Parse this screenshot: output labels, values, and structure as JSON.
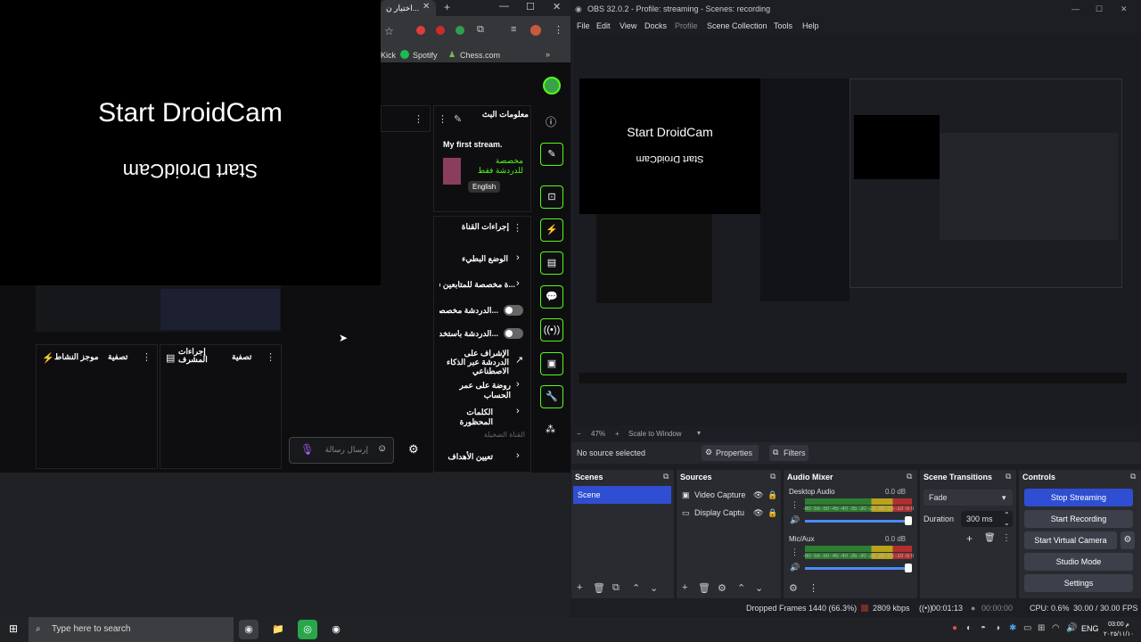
{
  "chrome": {
    "tab_title": "اختيار ن...",
    "bookmarks": [
      "Kick",
      "Spotify",
      "Chess.com"
    ],
    "droidcam_text": "Start DroidCam",
    "stream_info_title": "معلومات البث",
    "stream_name": "My first stream.",
    "stream_category": "مخصصة للدردشة فقط",
    "stream_language": "English",
    "channel_actions": "إجراءات القناة",
    "menu_items": [
      "الوضع البطيء",
      "...ة مخصصة للمتابعين فقط",
      "...الدردشة مخصصة",
      "...الدردشة باستخدام",
      "الإشراف على الدردشة عبر الذكاء الاصطناعي",
      "روضة على عمر الحساب",
      "الكلمات المحظورة"
    ],
    "faded_label": "القناة الضخيلة",
    "set_goals": "تعيين الأهداف",
    "chat_placeholder": "إرسال رسالة",
    "columns": [
      "موجز النشاط",
      "تصفية",
      "إجراءات المشرف",
      "تصفية"
    ]
  },
  "obs": {
    "title": "OBS 32.0.2 - Profile: streaming - Scenes: recording",
    "menu": [
      "File",
      "Edit",
      "View",
      "Docks",
      "Profile",
      "Scene Collection",
      "Tools",
      "Help"
    ],
    "zoom_percent": "47%",
    "zoom_mode": "Scale to Window",
    "no_source": "No source selected",
    "properties_label": "Properties",
    "filters_label": "Filters",
    "docks": {
      "scenes_title": "Scenes",
      "sources_title": "Sources",
      "mixer_title": "Audio Mixer",
      "transitions_title": "Scene Transitions",
      "controls_title": "Controls"
    },
    "scenes": [
      "Scene"
    ],
    "sources": [
      "Video Capture",
      "Display Captu"
    ],
    "mixer": [
      {
        "name": "Desktop Audio",
        "db": "0.0 dB"
      },
      {
        "name": "Mic/Aux",
        "db": "0.0 dB"
      }
    ],
    "meter_scale": "-60 -55 -50 -45 -40 -35 -30 -25 -20 -15 -10 -5 0",
    "transition": "Fade",
    "duration_label": "Duration",
    "duration_value": "300 ms",
    "controls": [
      "Stop Streaming",
      "Start Recording",
      "Start Virtual Camera",
      "Studio Mode",
      "Settings"
    ],
    "status": {
      "dropped_frames": "Dropped Frames 1440 (66.3%)",
      "bitrate": "2809 kbps",
      "stream_time": "00:01:13",
      "rec_time": "00:00:00",
      "cpu": "CPU: 0.6%",
      "fps": "30.00 / 30.00 FPS"
    }
  },
  "taskbar": {
    "search_placeholder": "Type here to search",
    "language": "ENG",
    "time": "03:00 م",
    "date": "٢٠٢٥/١١/١٠"
  },
  "colors": {
    "kick_green": "#53fc18",
    "obs_blue": "#2f4ed2"
  }
}
